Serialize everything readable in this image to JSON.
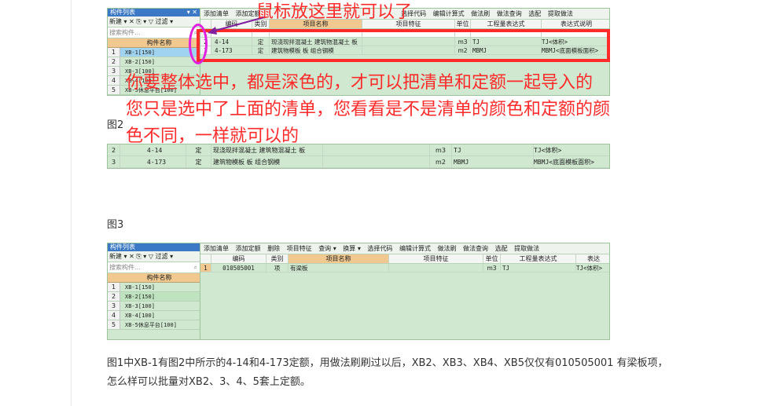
{
  "colors": {
    "panel_bg": "#cfe8cf",
    "header_orange": "#f0c890",
    "annotation_red": "#ff2a2a",
    "circle_magenta": "#e020e0",
    "title_blue": "#3b78c6",
    "selected_blue": "#9fd3ef"
  },
  "fig1": {
    "panel_title": "构件列表",
    "pin": "▾ ✕",
    "mini_toolbar": "新建 ▾ ✕ ⎘ ▾ ▽ 过滤 ▾",
    "search_placeholder": "搜索构件...",
    "component_header": "构件名称",
    "components": [
      {
        "idx": "1",
        "name": "XB-1[150]"
      },
      {
        "idx": "2",
        "name": "XB-2[150]"
      },
      {
        "idx": "3",
        "name": "XB-3[100]"
      },
      {
        "idx": "4",
        "name": "XB-4[100]"
      },
      {
        "idx": "5",
        "name": "XB-5休息平台[100]"
      }
    ],
    "toolbar": [
      "添加清单",
      "添加定额",
      "选择代码",
      "编辑计算式",
      "做法刷",
      "做法查询",
      "选配",
      "提取做法"
    ],
    "grid_headers": [
      "编码",
      "类别",
      "项目名称",
      "项目特征",
      "单位",
      "工程量表达式",
      "表达式说明"
    ],
    "rows": [
      {
        "idx": "1",
        "code": "",
        "type": "",
        "name": "",
        "feature": "",
        "unit": "",
        "expr": "",
        "desc": ""
      },
      {
        "idx": "2",
        "code": "4-14",
        "type": "定",
        "name": "现浇现拌混凝土 建筑物混凝土 板",
        "feature": "",
        "unit": "m3",
        "expr": "TJ",
        "desc": "TJ<体积>"
      },
      {
        "idx": "3",
        "code": "4-173",
        "type": "定",
        "name": "建筑物模板 板 组合钢模",
        "feature": "",
        "unit": "m2",
        "expr": "MBMJ",
        "desc": "MBMJ<底面模板面积>"
      }
    ]
  },
  "annotations": {
    "mouse_hint": "鼠标放这里就可以了",
    "main_text_1": "你要整体选中，都是深色的，才可以把清单和定额一起导入的",
    "main_text_2": "您只是选中了上面的清单，您看看是不是清单的颜色和定额的颜",
    "main_text_3": "色不同，一样就可以的"
  },
  "fig2": {
    "label": "图2",
    "rows": [
      {
        "idx": "2",
        "code": "4-14",
        "type": "定",
        "name": "现浇现拌混凝土 建筑物混凝土 板",
        "feature": "",
        "unit": "m3",
        "expr": "TJ",
        "desc": "TJ<体积>"
      },
      {
        "idx": "3",
        "code": "4-173",
        "type": "定",
        "name": "建筑物模板 板 组合钢模",
        "feature": "",
        "unit": "m2",
        "expr": "MBMJ",
        "desc": "MBMJ<底面模板面积>"
      }
    ]
  },
  "fig3": {
    "label": "图3",
    "panel_title": "构件列表",
    "mini_toolbar": "新建 ▾ ✕ ⎘ ▾ ▽ 过滤 ▾",
    "search_placeholder": "搜索构件...",
    "component_header": "构件名称",
    "components": [
      {
        "idx": "1",
        "name": "XB-1[150]"
      },
      {
        "idx": "2",
        "name": "XB-2[150]"
      },
      {
        "idx": "3",
        "name": "XB-3[100]"
      },
      {
        "idx": "4",
        "name": "XB-4[100]"
      },
      {
        "idx": "5",
        "name": "XB-5休息平台[100]"
      }
    ],
    "toolbar": [
      "添加清单",
      "添加定额",
      "删除",
      "项目特征",
      "查询 ▾",
      "换算 ▾",
      "选择代码",
      "编辑计算式",
      "做法刷",
      "做法查询",
      "选配",
      "提取做法"
    ],
    "grid_headers": [
      "编码",
      "类别",
      "项目名称",
      "项目特征",
      "单位",
      "工程量表达式",
      "表达"
    ],
    "rows": [
      {
        "idx": "1",
        "code": "010505001",
        "type": "项",
        "name": "有梁板",
        "feature": "",
        "unit": "m3",
        "expr": "TJ",
        "desc": "TJ<体积>"
      }
    ]
  },
  "question": {
    "line1": "图1中XB-1有图2中所示的4-14和4-173定额，用做法刷刷过以后，XB2、XB3、XB4、XB5仅仅有010505001 有梁板项，",
    "line2": "怎么样可以批量对XB2、3、4、5套上定额。"
  }
}
